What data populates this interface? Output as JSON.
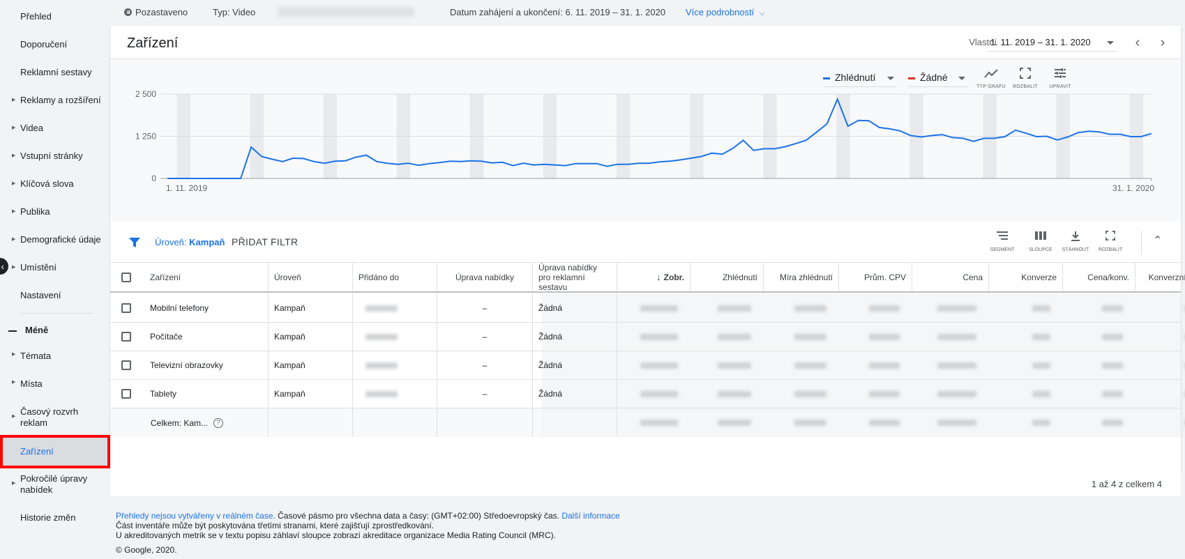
{
  "sidebar": {
    "items": [
      {
        "label": "Přehled",
        "arrow": false
      },
      {
        "label": "Doporučení",
        "arrow": false
      },
      {
        "label": "Reklamní sestavy",
        "arrow": false
      },
      {
        "label": "Reklamy a rozšíření",
        "arrow": true
      },
      {
        "label": "Videa",
        "arrow": true
      },
      {
        "label": "Vstupní stránky",
        "arrow": true
      },
      {
        "label": "Klíčová slova",
        "arrow": true
      },
      {
        "label": "Publika",
        "arrow": true
      },
      {
        "label": "Demografické údaje",
        "arrow": true
      },
      {
        "label": "Umístění",
        "arrow": true
      },
      {
        "label": "Nastavení",
        "arrow": false
      }
    ],
    "less_label": "Méně",
    "more_items": [
      {
        "label": "Témata",
        "arrow": true
      },
      {
        "label": "Místa",
        "arrow": true
      },
      {
        "label": "Časový rozvrh reklam",
        "arrow": true
      },
      {
        "label": "Zařízení",
        "arrow": false,
        "selected": true
      },
      {
        "label": "Pokročilé úpravy nabídek",
        "arrow": true
      },
      {
        "label": "Historie změn",
        "arrow": false
      }
    ]
  },
  "infobar": {
    "status": "Pozastaveno",
    "type": "Typ: Video",
    "dates_label": "Datum zahájení a ukončení: 6. 11. 2019 – 31. 1. 2020",
    "more_details": "Více podrobností"
  },
  "header": {
    "title": "Zařízení",
    "date_label": "Vlastní",
    "date_range": "1. 11. 2019 – 31. 1. 2020"
  },
  "chart_controls": {
    "metric1": "Zhlédnutí",
    "metric1_color": "#1a73e8",
    "metric2": "Žádné",
    "metric2_color": "#d93025",
    "chart_type": "TYP GRAFU",
    "expand": "ROZBALIT",
    "edit": "UPRAVIT"
  },
  "chart_data": {
    "type": "line",
    "yticks": [
      "0",
      "1 250",
      "2 500"
    ],
    "ylim": [
      0,
      2500
    ],
    "x_start_label": "1. 11. 2019",
    "x_end_label": "31. 1. 2020",
    "series": [
      {
        "name": "Zhlédnutí",
        "color": "#1a73e8",
        "values": [
          0,
          0,
          0,
          0,
          0,
          0,
          0,
          0,
          930,
          650,
          570,
          500,
          600,
          590,
          500,
          450,
          510,
          520,
          630,
          690,
          500,
          450,
          420,
          450,
          390,
          440,
          470,
          510,
          500,
          520,
          510,
          460,
          480,
          380,
          450,
          400,
          420,
          400,
          380,
          440,
          440,
          440,
          360,
          420,
          420,
          450,
          450,
          490,
          510,
          550,
          600,
          650,
          750,
          720,
          890,
          1130,
          830,
          880,
          880,
          940,
          1030,
          1130,
          1370,
          1620,
          2350,
          1550,
          1720,
          1710,
          1510,
          1470,
          1410,
          1270,
          1230,
          1270,
          1300,
          1210,
          1190,
          1100,
          1190,
          1190,
          1240,
          1430,
          1340,
          1240,
          1250,
          1140,
          1230,
          1360,
          1400,
          1380,
          1310,
          1310,
          1240,
          1240,
          1330
        ]
      }
    ],
    "weekend_bands": true
  },
  "filterbar": {
    "level_prefix": "Úroveň:",
    "level_value": "Kampaň",
    "add_filter": "PŘIDAT FILTR",
    "segment": "SEGMENT",
    "columns": "SLOUPCE",
    "download": "STÁHNOUT",
    "expand": "ROZBALIT"
  },
  "table": {
    "headers": {
      "device": "Zařízení",
      "level": "Úroveň",
      "added_to": "Přidáno do",
      "bid_adj": "Úprava nabídky",
      "bid_adj_group": "Úprava nabídky pro reklamní sestavu",
      "impressions": "Zobr.",
      "views": "Zhlédnutí",
      "view_rate": "Míra zhlédnutí",
      "avg_cpv": "Prům. CPV",
      "cost": "Cena",
      "conversions": "Konverze",
      "cost_conv": "Cena/konv.",
      "conv_rate": "Konverzní poměr"
    },
    "rows": [
      {
        "device": "Mobilní telefony",
        "level": "Kampaň",
        "bid_adj": "–",
        "bid_adj_group": "Žádná"
      },
      {
        "device": "Počítače",
        "level": "Kampaň",
        "bid_adj": "–",
        "bid_adj_group": "Žádná"
      },
      {
        "device": "Televizní obrazovky",
        "level": "Kampaň",
        "bid_adj": "–",
        "bid_adj_group": "Žádná"
      },
      {
        "device": "Tablety",
        "level": "Kampaň",
        "bid_adj": "–",
        "bid_adj_group": "Žádná"
      }
    ],
    "total_label": "Celkem: Kam...",
    "pager": "1 až 4 z celkem 4"
  },
  "footer": {
    "line1_link": "Přehledy nejsou vytvářeny v reálném čase.",
    "line1_text": " Časové pásmo pro všechna data a časy: (GMT+02:00) Středoevropský čas. ",
    "line1_link2": "Další informace",
    "line2": "Část inventáře může být poskytována třetími stranami, které zajišťují zprostředkování.",
    "line3": "U akreditovaných metrik se v textu popisu záhlaví sloupce zobrazí akreditace organizace Media Rating Council (MRC).",
    "copyright": "© Google, 2020."
  }
}
